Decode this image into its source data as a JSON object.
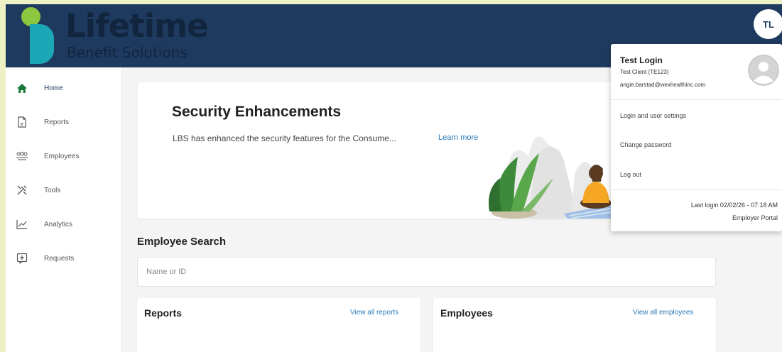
{
  "brand": {
    "name": "Lifetime",
    "subtitle": "Benefit Solutions"
  },
  "header": {
    "user_initials": "TL"
  },
  "sidebar": {
    "items": [
      {
        "label": "Home",
        "icon": "home-icon",
        "active": true
      },
      {
        "label": "Reports",
        "icon": "document-icon",
        "active": false
      },
      {
        "label": "Employees",
        "icon": "people-icon",
        "active": false
      },
      {
        "label": "Tools",
        "icon": "tools-icon",
        "active": false
      },
      {
        "label": "Analytics",
        "icon": "chart-icon",
        "active": false
      },
      {
        "label": "Requests",
        "icon": "request-icon",
        "active": false
      }
    ]
  },
  "banner": {
    "title": "Security Enhancements",
    "text": "LBS has enhanced the security features for the Consume...",
    "link": "Learn more"
  },
  "employee_search": {
    "title": "Employee Search",
    "placeholder": "Name or ID"
  },
  "cards": {
    "reports": {
      "title": "Reports",
      "link": "View all reports"
    },
    "employees": {
      "title": "Employees",
      "link": "View all employees"
    }
  },
  "user_menu": {
    "name": "Test Login",
    "client": "Test Client (TE123)",
    "email": "angie.barstad@wexhealthinc.com",
    "items": [
      "Login and user settings",
      "Change password",
      "Log out"
    ],
    "last_login": "Last login 02/02/26 - 07:18 AM",
    "portal": "Employer Portal"
  },
  "colors": {
    "header_bg": "#1f3a5f",
    "accent_green": "#8dc63f",
    "accent_teal": "#1ba7b5",
    "link": "#2a7ab8",
    "active_icon": "#1d7a3a"
  }
}
